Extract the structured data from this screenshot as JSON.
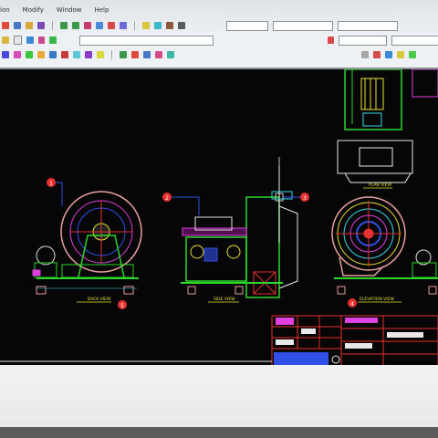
{
  "menu": {
    "items": [
      "ion",
      "Modify",
      "Window",
      "Help"
    ]
  },
  "toolbar": {
    "layer_box": "",
    "style_box": ""
  },
  "drawing": {
    "views": {
      "back": "BACK VIEW",
      "side": "SIDE VIEW",
      "elevation": "ELEVATION VIEW",
      "plan": "PLAN VIEW"
    },
    "balloons": [
      "1",
      "2",
      "3",
      "4",
      "5"
    ]
  },
  "colors": {
    "background": "#050605",
    "green": "#2bd82b",
    "magenta": "#e040e0",
    "cyan": "#38d8e8",
    "yellow": "#e8e030",
    "red": "#e83030",
    "blue": "#3050e8"
  }
}
